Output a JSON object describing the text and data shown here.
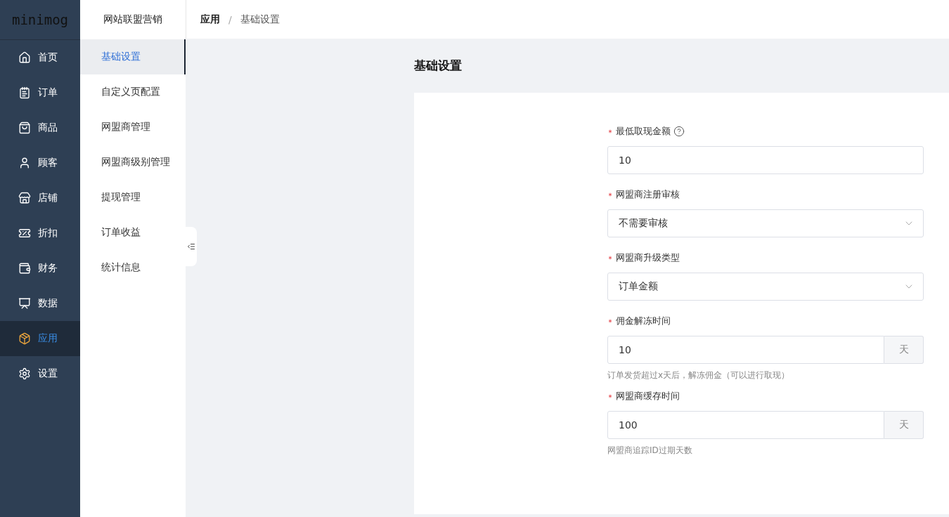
{
  "logo": "minimog",
  "nav": [
    {
      "label": "首页",
      "selected": false
    },
    {
      "label": "订单",
      "selected": false
    },
    {
      "label": "商品",
      "selected": false
    },
    {
      "label": "顾客",
      "selected": false
    },
    {
      "label": "店铺",
      "selected": false
    },
    {
      "label": "折扣",
      "selected": false
    },
    {
      "label": "财务",
      "selected": false
    },
    {
      "label": "数据",
      "selected": false
    },
    {
      "label": "应用",
      "selected": true
    },
    {
      "label": "设置",
      "selected": false
    }
  ],
  "submenu": {
    "title": "网站联盟营销",
    "items": [
      {
        "label": "基础设置",
        "selected": true
      },
      {
        "label": "自定义页配置",
        "selected": false
      },
      {
        "label": "网盟商管理",
        "selected": false
      },
      {
        "label": "网盟商级别管理",
        "selected": false
      },
      {
        "label": "提现管理",
        "selected": false
      },
      {
        "label": "订单收益",
        "selected": false
      },
      {
        "label": "统计信息",
        "selected": false
      }
    ]
  },
  "breadcrumb": [
    {
      "label": "应用",
      "current": false
    },
    {
      "label": "基础设置",
      "current": true
    }
  ],
  "breadcrumb_separator": "/",
  "page_title": "基础设置",
  "form": [
    {
      "kind": "text",
      "label": "最低取现金额",
      "required": true,
      "help": true,
      "value": "10"
    },
    {
      "kind": "select",
      "label": "网盟商注册审核",
      "required": true,
      "value": "不需要审核"
    },
    {
      "kind": "select",
      "label": "网盟商升级类型",
      "required": true,
      "value": "订单金额"
    },
    {
      "kind": "addon",
      "label": "佣金解冻时间",
      "required": true,
      "value": "10",
      "addon": "天",
      "hint": "订单发货超过x天后，解冻佣金（可以进行取现）"
    },
    {
      "kind": "addon",
      "label": "网盟商缓存时间",
      "required": true,
      "value": "100",
      "addon": "天",
      "hint": "网盟商追踪ID过期天数"
    }
  ]
}
